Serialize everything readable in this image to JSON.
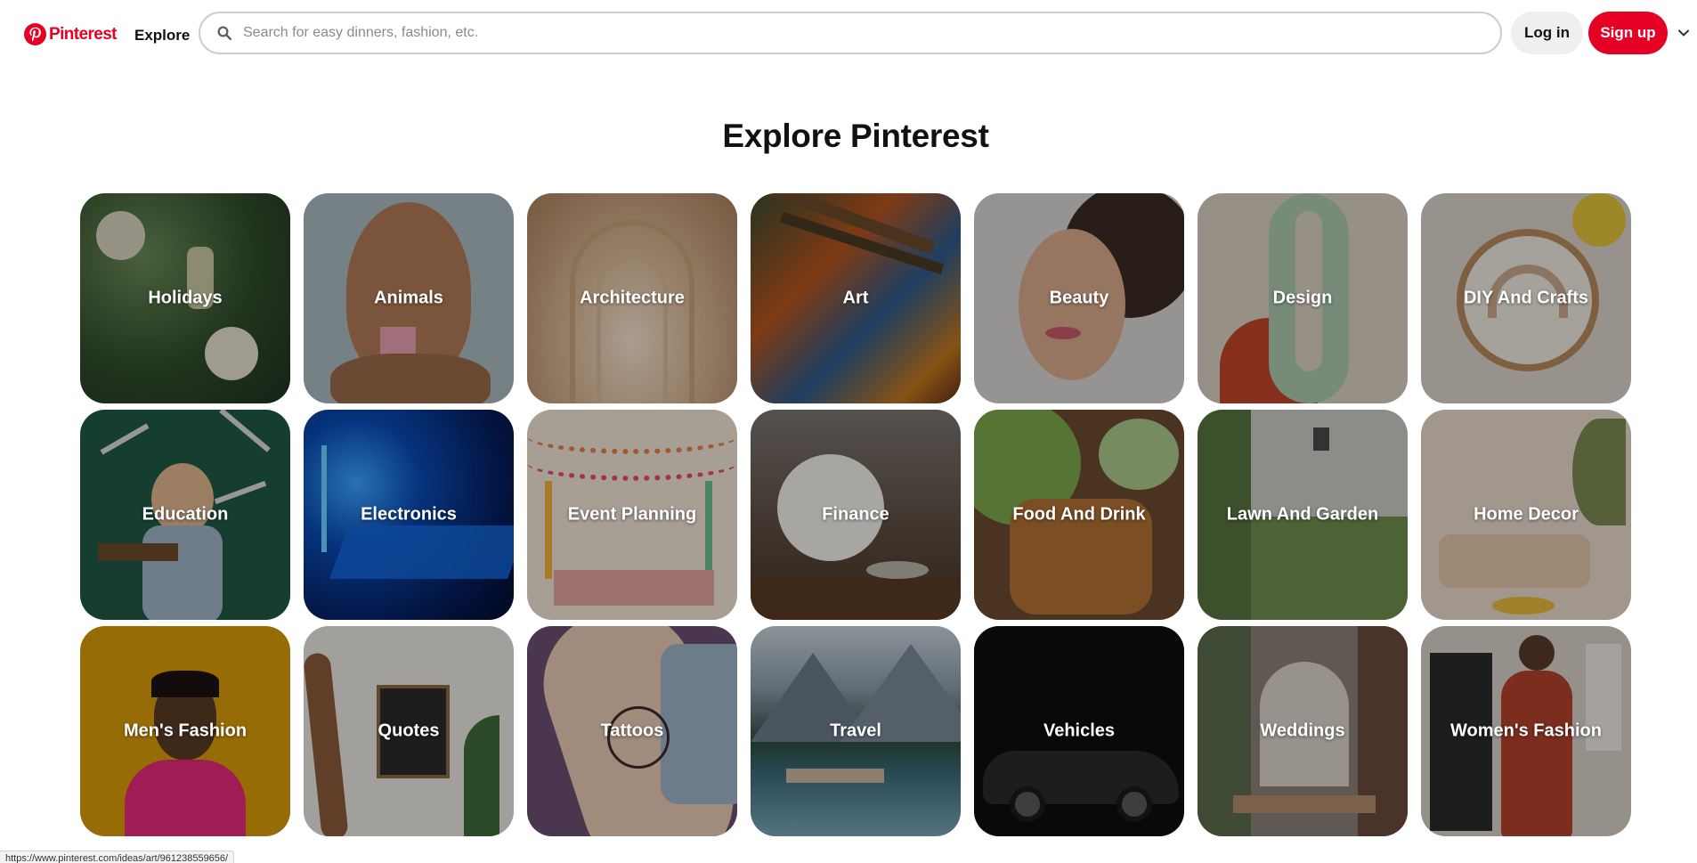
{
  "header": {
    "logo_text": "Pinterest",
    "explore_label": "Explore",
    "search_placeholder": "Search for easy dinners, fashion, etc.",
    "login_label": "Log in",
    "signup_label": "Sign up",
    "brand_color": "#e60023"
  },
  "main": {
    "title": "Explore Pinterest",
    "categories": [
      {
        "label": "Holidays"
      },
      {
        "label": "Animals"
      },
      {
        "label": "Architecture"
      },
      {
        "label": "Art"
      },
      {
        "label": "Beauty"
      },
      {
        "label": "Design"
      },
      {
        "label": "DIY And Crafts"
      },
      {
        "label": "Education"
      },
      {
        "label": "Electronics"
      },
      {
        "label": "Event Planning"
      },
      {
        "label": "Finance"
      },
      {
        "label": "Food And Drink"
      },
      {
        "label": "Lawn And Garden"
      },
      {
        "label": "Home Decor"
      },
      {
        "label": "Men's Fashion"
      },
      {
        "label": "Quotes"
      },
      {
        "label": "Tattoos"
      },
      {
        "label": "Travel"
      },
      {
        "label": "Vehicles"
      },
      {
        "label": "Weddings"
      },
      {
        "label": "Women's Fashion"
      }
    ]
  },
  "statusbar": {
    "url": "https://www.pinterest.com/ideas/art/961238559656/"
  }
}
